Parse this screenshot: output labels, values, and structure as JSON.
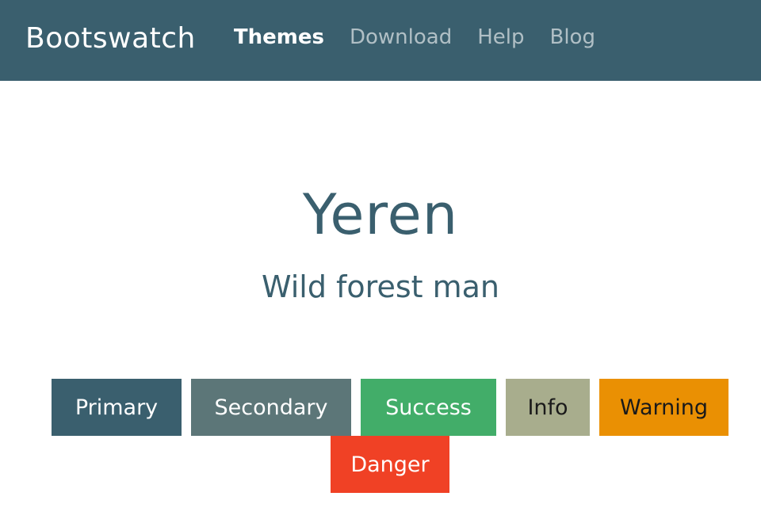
{
  "navbar": {
    "brand": "Bootswatch",
    "links": [
      {
        "label": "Themes",
        "active": true
      },
      {
        "label": "Download",
        "active": false
      },
      {
        "label": "Help",
        "active": false
      },
      {
        "label": "Blog",
        "active": false
      }
    ]
  },
  "hero": {
    "title": "Yeren",
    "subtitle": "Wild forest man"
  },
  "buttons": {
    "primary": "Primary",
    "secondary": "Secondary",
    "success": "Success",
    "info": "Info",
    "warning": "Warning",
    "danger": "Danger"
  },
  "colors": {
    "navbar_bg": "#3a5f6e",
    "primary": "#3a5f6e",
    "secondary": "#5c7678",
    "success": "#42ad69",
    "info": "#a8ad8d",
    "warning": "#ea9003",
    "danger": "#f04125"
  }
}
